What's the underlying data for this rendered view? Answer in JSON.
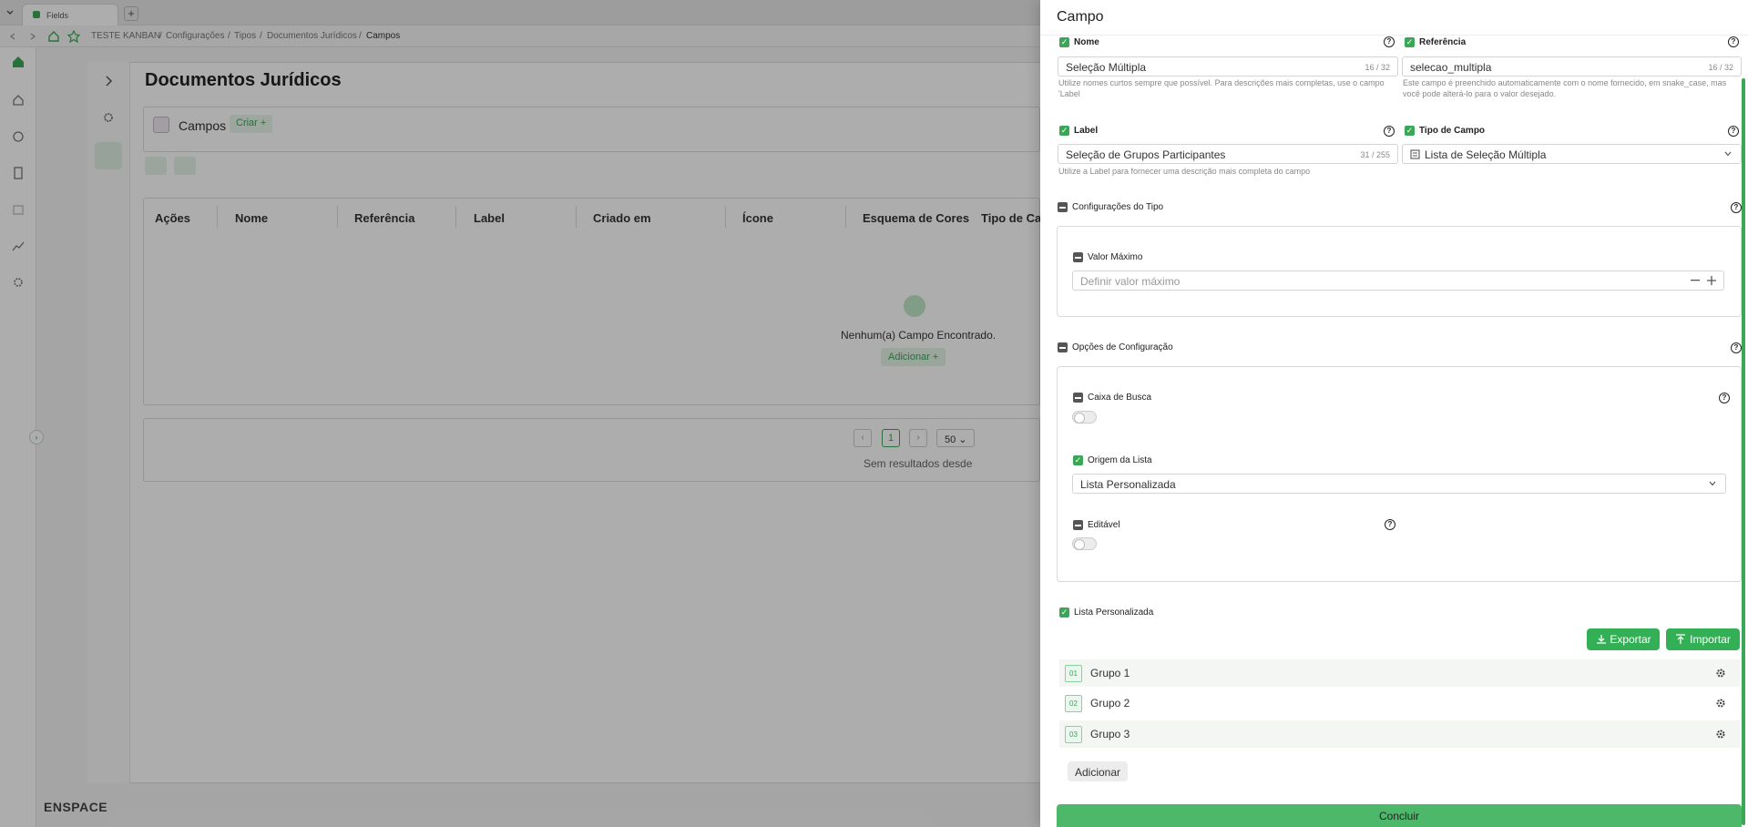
{
  "browser": {
    "tab_title": "Fields",
    "breadcrumb": [
      "TESTE KANBAN",
      "Configurações",
      "Tipos",
      "Documentos Jurídicos",
      "Campos"
    ]
  },
  "background": {
    "page_title": "Documentos Jurídicos",
    "section_title": "Campos",
    "create_label": "Criar +",
    "table_headers": [
      "Ações",
      "Nome",
      "Referência",
      "Label",
      "Criado em",
      "Ícone",
      "Esquema de Cores",
      "Tipo de Cam"
    ],
    "empty_text": "Nenhum(a) Campo Encontrado.",
    "add_label": "Adicionar +",
    "page_current": "1",
    "page_size": "50",
    "results_text": "Sem resultados desde",
    "brand": "ENSPACE"
  },
  "drawer": {
    "title": "Campo",
    "nome": {
      "label": "Nome",
      "value": "Seleção Múltipla",
      "counter": "16 / 32",
      "hint": "Utilize nomes curtos sempre que possível. Para descrições mais completas, use o campo 'Label"
    },
    "referencia": {
      "label": "Referência",
      "value": "selecao_multipla",
      "counter": "16 / 32",
      "hint": "Este campo é preenchido automaticamente com o nome fornecido, em snake_case, mas você pode alterá-lo para o valor desejado."
    },
    "label_field": {
      "label": "Label",
      "value": "Seleção de Grupos Participantes",
      "counter": "31 / 255",
      "hint": "Utilize a Label para fornecer uma descrição mais completa do campo"
    },
    "tipo_campo": {
      "label": "Tipo de Campo",
      "value": "Lista de Seleção Múltipla"
    },
    "config_tipo": {
      "label": "Configurações do Tipo",
      "valor_maximo": {
        "label": "Valor Máximo",
        "placeholder": "Definir valor máximo"
      }
    },
    "opcoes": {
      "label": "Opções de Configuração",
      "caixa_busca": "Caixa de Busca",
      "origem_lista": "Origem da Lista",
      "origem_valor": "Lista Personalizada",
      "editavel": "Editável"
    },
    "lista": {
      "label": "Lista Personalizada",
      "export_label": "Exportar",
      "import_label": "Importar",
      "items": [
        {
          "num": "01",
          "label": "Grupo 1"
        },
        {
          "num": "02",
          "label": "Grupo 2"
        },
        {
          "num": "03",
          "label": "Grupo 3"
        }
      ],
      "add_label": "Adicionar"
    },
    "submit_label": "Concluir",
    "accent": "#3aa757"
  }
}
